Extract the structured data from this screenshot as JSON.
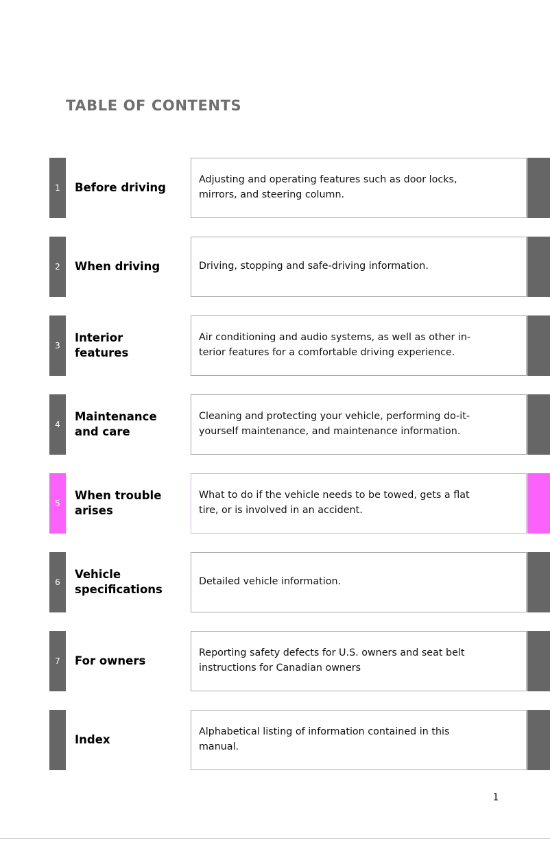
{
  "document": {
    "title": "TABLE OF CONTENTS",
    "page_number": "1"
  },
  "colors": {
    "tab_default": "#666666",
    "tab_accent": "#fb62fb",
    "accent_border": "#e8a8e8",
    "box_border": "#a8a8a8",
    "title_text": "#6f6f6f",
    "body_text": "#111111"
  },
  "rows": [
    {
      "number": "1",
      "label": "Before driving",
      "description": "Adjusting and operating features such as door locks,\nmirrors, and steering column.",
      "highlighted": false
    },
    {
      "number": "2",
      "label": "When driving",
      "description": "Driving, stopping and safe-driving information.",
      "highlighted": false
    },
    {
      "number": "3",
      "label": "Interior\nfeatures",
      "description": "Air conditioning and audio systems, as well as other in-\nterior features for a comfortable driving experience.",
      "highlighted": false
    },
    {
      "number": "4",
      "label": "Maintenance\nand care",
      "description": "Cleaning and protecting your vehicle, performing do-it-\nyourself maintenance, and maintenance information.",
      "highlighted": false
    },
    {
      "number": "5",
      "label": "When trouble\narises",
      "description": "What to do if the vehicle needs to be towed, gets a flat\ntire, or is involved in an accident.",
      "highlighted": true
    },
    {
      "number": "6",
      "label": "Vehicle\nspecifications",
      "description": "Detailed vehicle information.",
      "highlighted": false
    },
    {
      "number": "7",
      "label": "For owners",
      "description": "Reporting safety defects for U.S. owners and seat belt\ninstructions for Canadian owners",
      "highlighted": false
    },
    {
      "number": "",
      "label": "Index",
      "description": "Alphabetical listing of information contained in this\nmanual.",
      "highlighted": false
    }
  ]
}
